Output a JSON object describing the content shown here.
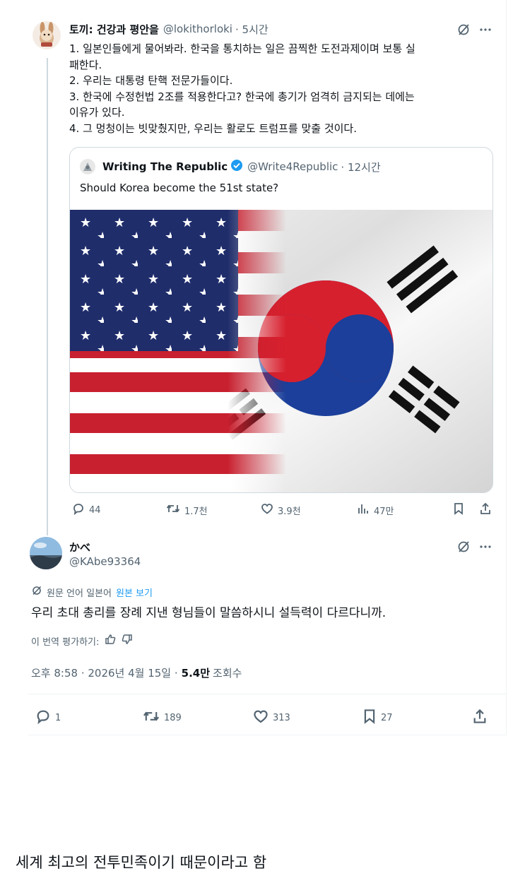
{
  "tweet1": {
    "display_name": "토끼: 건강과 평안을",
    "handle": "@lokithorloki",
    "time": "· 5시간",
    "lines": [
      "1. 일본인들에게 물어봐라. 한국을 통치하는 일은 끔찍한 도전과제이며 보통 실",
      "패한다.",
      "2. 우리는 대통령 탄핵 전문가들이다.",
      "3. 한국에 수정헌법 2조를 적용한다고? 한국에 총기가 엄격히 금지되는 데에는",
      "이유가 있다.",
      "4. 그 멍청이는 빗맞췄지만, 우리는 활로도 트럼프를 맞출 것이다."
    ],
    "quote": {
      "display_name": "Writing The Republic",
      "handle": "@Write4Republic",
      "time": "· 12시간",
      "text": "Should Korea become the 51st state?",
      "image_alt": "US flag and South Korean flag blended"
    },
    "stats": {
      "replies": "44",
      "retweets": "1.7천",
      "likes": "3.9천",
      "views": "47만"
    }
  },
  "tweet2": {
    "display_name": "かべ",
    "handle": "@KAbe93364",
    "translation_note": "원문 언어 일본어",
    "show_original": "원본 보기",
    "text": "우리 초대 총리를 장례 지낸 형님들이 말씀하시니 설득력이 다르다니까.",
    "rate_translation": "이 번역 평가하기:",
    "timestamp": "오후 8:58 · 2026년 4월 15일 ·",
    "views_count": "5.4만",
    "views_label": "조회수",
    "stats": {
      "replies": "1",
      "retweets": "189",
      "likes": "313",
      "bookmarks": "27"
    }
  },
  "caption": "세계 최고의 전투민족이기 때문이라고 함",
  "icons": {
    "grok": "grok-icon",
    "more": "more-icon",
    "verified": "verified-badge-icon",
    "reply": "reply-icon",
    "retweet": "retweet-icon",
    "like": "heart-icon",
    "views": "views-chart-icon",
    "bookmark": "bookmark-icon",
    "share": "share-icon",
    "translate": "translate-icon",
    "thumbs_up": "thumbs-up-icon",
    "thumbs_down": "thumbs-down-icon"
  },
  "colors": {
    "link": "#1d9bf0",
    "muted": "#536471",
    "text": "#0f1419",
    "border": "#cfd9de"
  }
}
